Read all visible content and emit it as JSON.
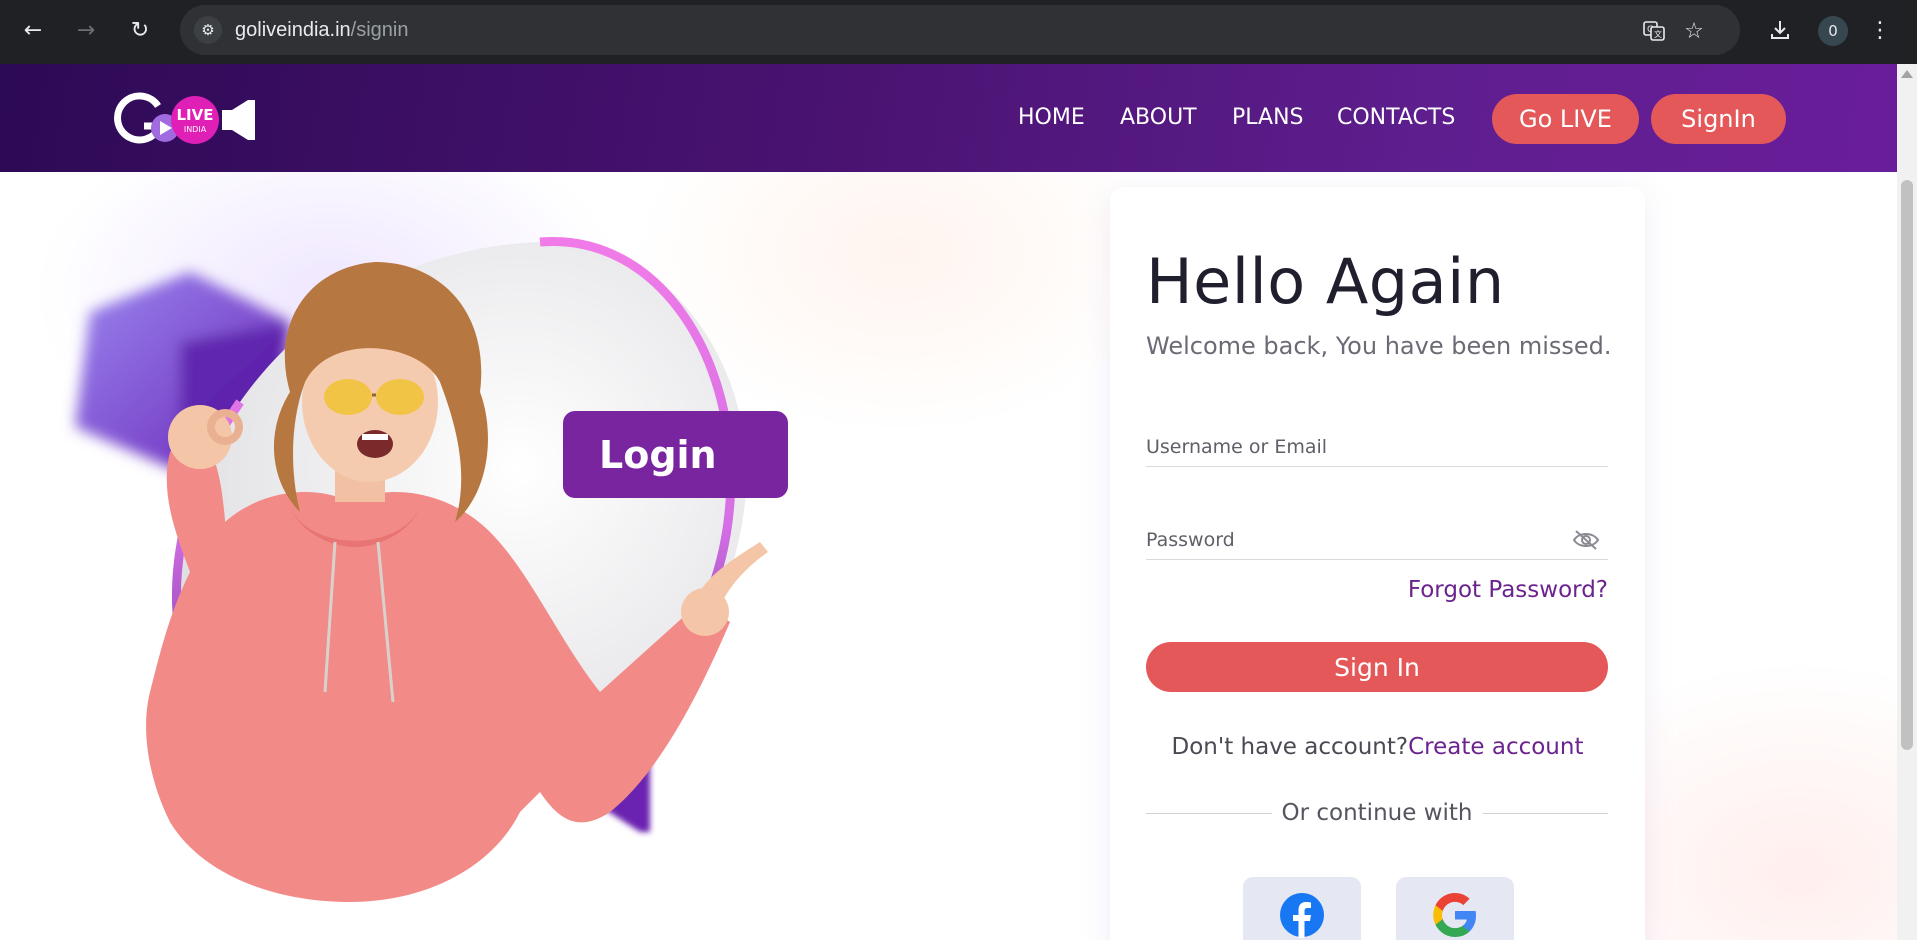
{
  "browser": {
    "url_host": "goliveindia.in",
    "url_path": "/signin",
    "profile_initial": "0",
    "icons": [
      "back-arrow-icon",
      "forward-arrow-icon",
      "reload-icon",
      "site-info-icon",
      "translate-icon",
      "star-icon",
      "download-icon",
      "more-vert-icon"
    ]
  },
  "header": {
    "logo_text": "LIVE",
    "logo_subtext": "INDIA",
    "nav": [
      "HOME",
      "ABOUT",
      "PLANS",
      "CONTACTS"
    ],
    "go_live_label": "Go LIVE",
    "signin_label": "SignIn",
    "colors": {
      "header_start": "#2d0a55",
      "header_end": "#6a1d9a",
      "accent": "#e4585a"
    }
  },
  "hero": {
    "tag_label": "Login"
  },
  "card": {
    "title": "Hello Again",
    "subtitle": "Welcome back, You have been missed.",
    "username_placeholder": "Username or Email",
    "password_placeholder": "Password",
    "forgot_label": "Forgot Password?",
    "signin_button": "Sign In",
    "no_account_text": "Don't have account?",
    "create_account_label": "Create account",
    "divider_text": "Or continue with",
    "social": [
      "facebook-icon",
      "google-icon"
    ],
    "colors": {
      "link": "#6b238e",
      "button": "#e4585a"
    }
  }
}
